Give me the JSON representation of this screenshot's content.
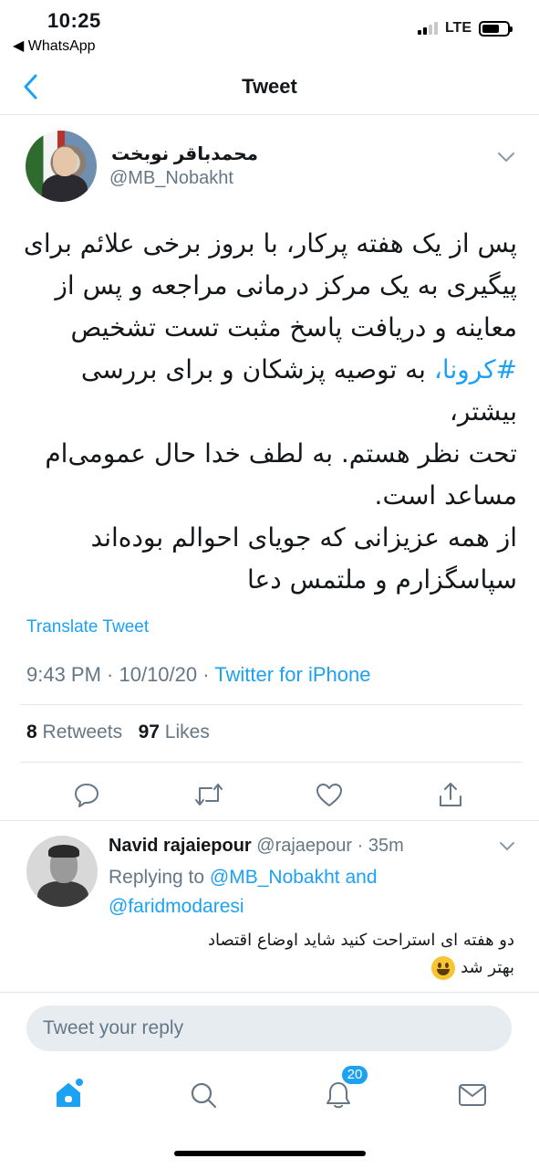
{
  "status": {
    "time": "10:25",
    "back_app": "◀ WhatsApp",
    "network": "LTE"
  },
  "nav": {
    "title": "Tweet"
  },
  "tweet": {
    "display_name": "محمدباقر نوبخت",
    "handle": "@MB_Nobakht",
    "lines": [
      "پس از یک هفته پرکار، با بروز برخی علائم برای",
      "پیگیری به یک مرکز درمانی مراجعه و پس از",
      "معاینه و دریافت پاسخ مثبت تست تشخیص",
      "به توصیه پزشکان و برای بررسی بیشتر،",
      "تحت نظر هستم. به لطف خدا حال عمومی‌ام",
      "مساعد است.",
      "از همه عزیزانی که جویای احوالم بوده‌اند",
      "سپاسگزارم و ملتمس دعا"
    ],
    "hashtag": "#کرونا،",
    "translate_label": "Translate Tweet",
    "time": "9:43 PM · 10/10/20 · ",
    "source": "Twitter for iPhone",
    "retweets_count": "8",
    "retweets_label": "Retweets",
    "likes_count": "97",
    "likes_label": "Likes"
  },
  "reply": {
    "name": "Navid rajaiepour",
    "handle": "@rajaepour · 35m",
    "replying_prefix": "Replying to",
    "mention1": "@MB_Nobakht and",
    "mention2": "@faridmodaresi",
    "line1": "دو هفته ای استراحت کنید شاید اوضاع اقتصاد",
    "line2": "بهتر شد"
  },
  "compose": {
    "placeholder": "Tweet your reply"
  },
  "tabbar": {
    "notifications_badge": "20"
  },
  "colors": {
    "accent": "#1da1f2",
    "secondary_text": "#657786",
    "divider": "#e1e8ed"
  },
  "icons": [
    "chevron-left-icon",
    "chevron-down-icon",
    "reply-icon",
    "retweet-icon",
    "like-icon",
    "share-icon",
    "home-icon",
    "search-icon",
    "notifications-icon",
    "messages-icon"
  ]
}
